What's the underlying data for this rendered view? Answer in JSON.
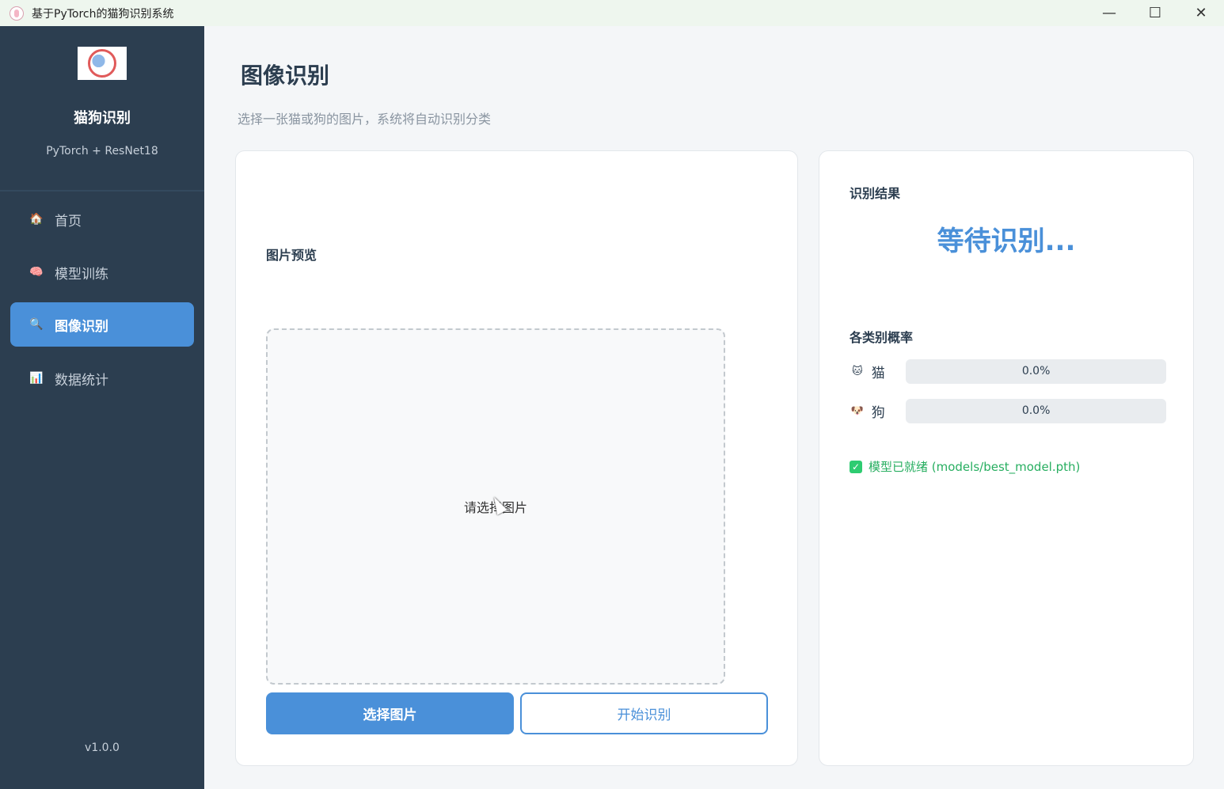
{
  "window": {
    "title": "基于PyTorch的猫狗识别系统",
    "controls": {
      "minimize": "—",
      "maximize": "☐",
      "close": "✕"
    }
  },
  "sidebar": {
    "brand_title": "猫狗识别",
    "brand_subtitle": "PyTorch + ResNet18",
    "items": [
      {
        "label": "首页",
        "icon": "house-icon",
        "glyph": "🏠",
        "active": false
      },
      {
        "label": "模型训练",
        "icon": "brain-icon",
        "glyph": "🧠",
        "active": false
      },
      {
        "label": "图像识别",
        "icon": "magnifier-icon",
        "glyph": "🔍",
        "active": true
      },
      {
        "label": "数据统计",
        "icon": "bar-chart-icon",
        "glyph": "📊",
        "active": false
      }
    ],
    "version": "v1.0.0"
  },
  "main": {
    "title": "图像识别",
    "subtitle": "选择一张猫或狗的图片，系统将自动识别分类",
    "preview": {
      "label": "图片预览",
      "placeholder": "请选择图片"
    },
    "buttons": {
      "select": "选择图片",
      "start": "开始识别"
    },
    "result": {
      "label": "识别结果",
      "status": "等待识别...",
      "prob_label": "各类别概率",
      "probs": [
        {
          "name": "猫",
          "emoji": "🐱",
          "value": 0.0,
          "display": "0.0%"
        },
        {
          "name": "狗",
          "emoji": "🐶",
          "value": 0.0,
          "display": "0.0%"
        }
      ],
      "model_status": "模型已就绪 (models/best_model.pth)"
    }
  },
  "colors": {
    "accent": "#4a90d9",
    "sidebar_bg": "#2c3e50",
    "success": "#27ae60"
  }
}
